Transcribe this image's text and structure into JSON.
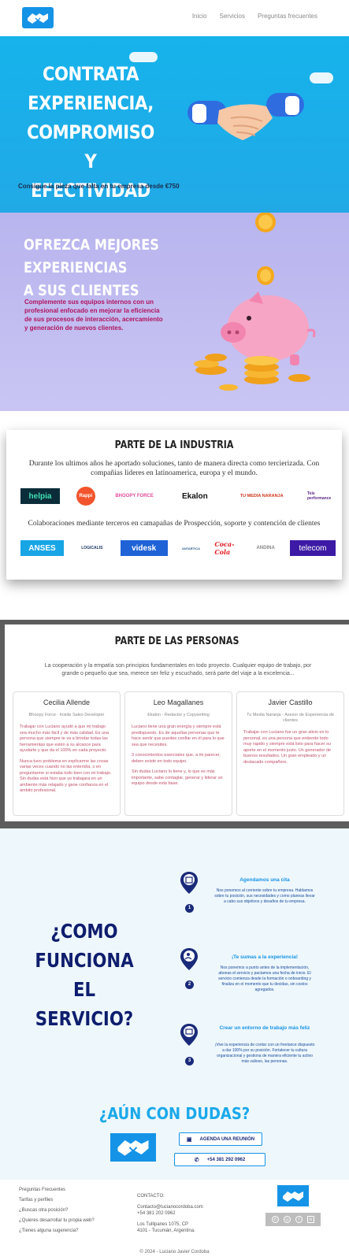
{
  "header": {
    "nav": [
      "Inicio",
      "Servicios",
      "Preguntas frecuentes"
    ]
  },
  "hero": {
    "title_lines": [
      "CONTRATA",
      "EXPERIENCIA,",
      "COMPROMISO Y",
      "EFECTIVIDAD"
    ],
    "subtitle": "Consigue la pieza que falta en tu empresa desde €750"
  },
  "experiences": {
    "title_lines": [
      "OFREZCA MEJORES EXPERIENCIAS",
      "A SUS CLIENTES"
    ],
    "text": "Complemente sus equipos internos con un profesional enfocado en mejorar la eficiencia de sus procesos de interacción, acercamiento y generación de nuevos clientes."
  },
  "industry": {
    "title": "PARTE DE LA INDUSTRIA",
    "text1": "Durante los ultimos años he aportado soluciones, tanto de manera directa como tercierizada. Con compañias lideres en latinoamerica, europa y el mundo.",
    "text2": "Colaboraciones mediante terceros en camapañas de Prospección, soporte y contención de clientes",
    "logos_row1": [
      "helpia",
      "Rappi",
      "BHOOPY FORCE",
      "Ekalon",
      "TU MEDIA NARANJA",
      "Tele performance"
    ],
    "logos_row2": [
      "ANSES",
      "LOGICALIS",
      "videsk",
      "ANTARTICA",
      "Coca-Cola",
      "ANDINA",
      "telecom"
    ]
  },
  "people": {
    "title": "PARTE DE LAS PERSONAS",
    "intro": "La cooperación y la empatía son principios fundamentales en todo proyecto. Cualquier equipo de trabajo, por grande o pequeño que sea, merece ser feliz y escuchado, será parte del viaje a la excelencia...",
    "cards": [
      {
        "name": "Cecilia Allende",
        "role": "Bhoopy Force - Inside Sales Developer",
        "paras": [
          "Trabajar con Luciano ayudó a que mi trabajo sea mucho más fácil y de más calidad. Es una persona que siempre te va a brindar todas las herramientas que estén a su alcance para ayudarte y que da el 100% en cada proyecto.",
          "Nunca tuvo problema en explicarme las cosas varias veces cuando no las entendía, o en preguntarme si estaba todo bien con mi trabajo. Sin dudas está hizo que yo trabajara en un ambiente más relajado y gane confianza en el ámbito profesional."
        ]
      },
      {
        "name": "Leo Magallanes",
        "role": "Ekalon - Redactor y Copywriting",
        "paras": [
          "Luciano tiene una gran energía y siempre está predispuesto. Es de aquellas personas que te hace sentir que puedes confiar en él para lo que sea que necesites.",
          "3 conocimientos esenciales que, a mi parecer, deben existir en todo equipo.",
          "Sin dudas Luciano lo tiene y, lo que es más importante, sabe contagiar, generar y liderar un equipo desde esta base."
        ]
      },
      {
        "name": "Javier Castillo",
        "role": "Tu Media Naranja - Asesor de Experiencia de clientes",
        "paras": [
          "Trabajar con Luciano fue un gran alivio en lo personal, es una persona que entiende todo muy rapido y siempre está listo para hacer su aporte en el momento justo. Un generador de buenos resultados. Un gran empleado y un destacado compañero."
        ]
      }
    ]
  },
  "how": {
    "title_lines": [
      "¿COMO",
      "FUNCIONA EL",
      "SERVICIO?"
    ],
    "steps": [
      {
        "num": "1",
        "title": "Agendamos una cita",
        "text": "Nos ponemos al corriente sobre tu empresa. Hablamos sobre tu posición, sus necesidades y como planeas llevar a cabo sus objetivos y desafios de tu empresa."
      },
      {
        "num": "2",
        "title": "¡Te sumas a la experiencia!",
        "text": "Nos ponemos a punto antes de la implementación, abonas el servicio y pactamos una fecha de inicio. El servicio comienza desde la formación o onboarding y finaliza en el momento que tu decidas, sin costos agregados."
      },
      {
        "num": "3",
        "title": "Crear un entorno de trabajo más feliz",
        "text": "¡Vive la experiencia de contar con un freelance dispuesto a dar 100% por su posición. Fortalecer tu cultura organizacional y gestiona de manera eficiente tu activo más valioso, las personas."
      }
    ],
    "doubt": "¿AÚN CON DUDAS?",
    "cta_meeting": "AGENDA UNA REUNIÓN",
    "cta_phone": "+54 381 292 0962"
  },
  "footer": {
    "links": [
      "Preguntas Frecuentes",
      "Tarifas y perfiles",
      "¿Buscas otra posición?",
      "¿Quieres desarrollar tu propia web?",
      "¿Tienes alguna sugerencia?"
    ],
    "contact_title": "CONTACTO:",
    "contact_email": "Contacto@lucianocordoba.com",
    "contact_phone": "+54 381 202 0962",
    "address1": "Los Tullipanes 1075, CP",
    "address2": "4101 - Tucumán, Argentina.",
    "copyright": "© 2024 - Luciano Javier Cordoba"
  },
  "colors": {
    "brand_blue": "#1593e6",
    "hero_bg": "#16b3ec",
    "lavender_bg": "#b8b4ee",
    "navy": "#0f1d6e",
    "magenta": "#b0135e"
  }
}
